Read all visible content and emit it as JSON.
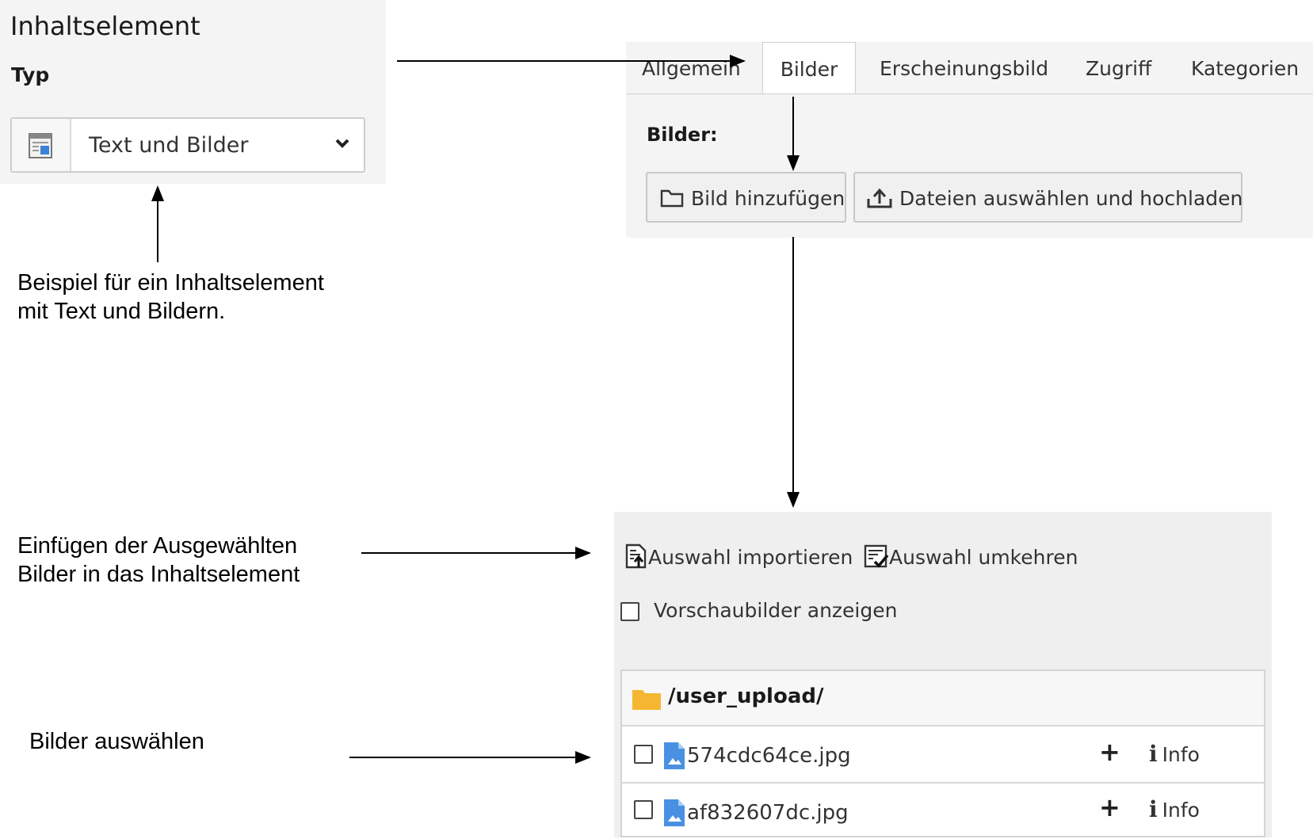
{
  "type_panel": {
    "title": "Inhaltselement",
    "label": "Typ",
    "selected": "Text und Bilder"
  },
  "images_panel": {
    "tabs": [
      {
        "label": "Allgemein",
        "active": false
      },
      {
        "label": "Bilder",
        "active": true
      },
      {
        "label": "Erscheinungsbild",
        "active": false
      },
      {
        "label": "Zugriff",
        "active": false
      },
      {
        "label": "Kategorien",
        "active": false
      }
    ],
    "field_label": "Bilder:",
    "add_image_button": "Bild hinzufügen",
    "upload_button": "Dateien auswählen und hochladen"
  },
  "browser_panel": {
    "import_action": "Auswahl importieren",
    "invert_action": "Auswahl umkehren",
    "thumbnails_label": "Vorschaubilder anzeigen",
    "folder": "/user_upload/",
    "files": [
      {
        "name": "574cdc64ce.jpg",
        "add": "+",
        "info_icon": "i",
        "info": "Info"
      },
      {
        "name": "af832607dc.jpg",
        "add": "+",
        "info_icon": "i",
        "info": "Info"
      }
    ]
  },
  "annotations": {
    "example_line1": "Beispiel für ein Inhaltselement",
    "example_line2": "mit Text und Bildern.",
    "insert_line1": "Einfügen der Ausgewählten",
    "insert_line2": "Bilder in das Inhaltselement",
    "select": "Bilder auswählen"
  },
  "colors": {
    "panel_bg": "#f4f4f4",
    "browser_bg": "#efefef",
    "folder_icon": "#f5b731",
    "image_icon": "#4a90e2"
  }
}
